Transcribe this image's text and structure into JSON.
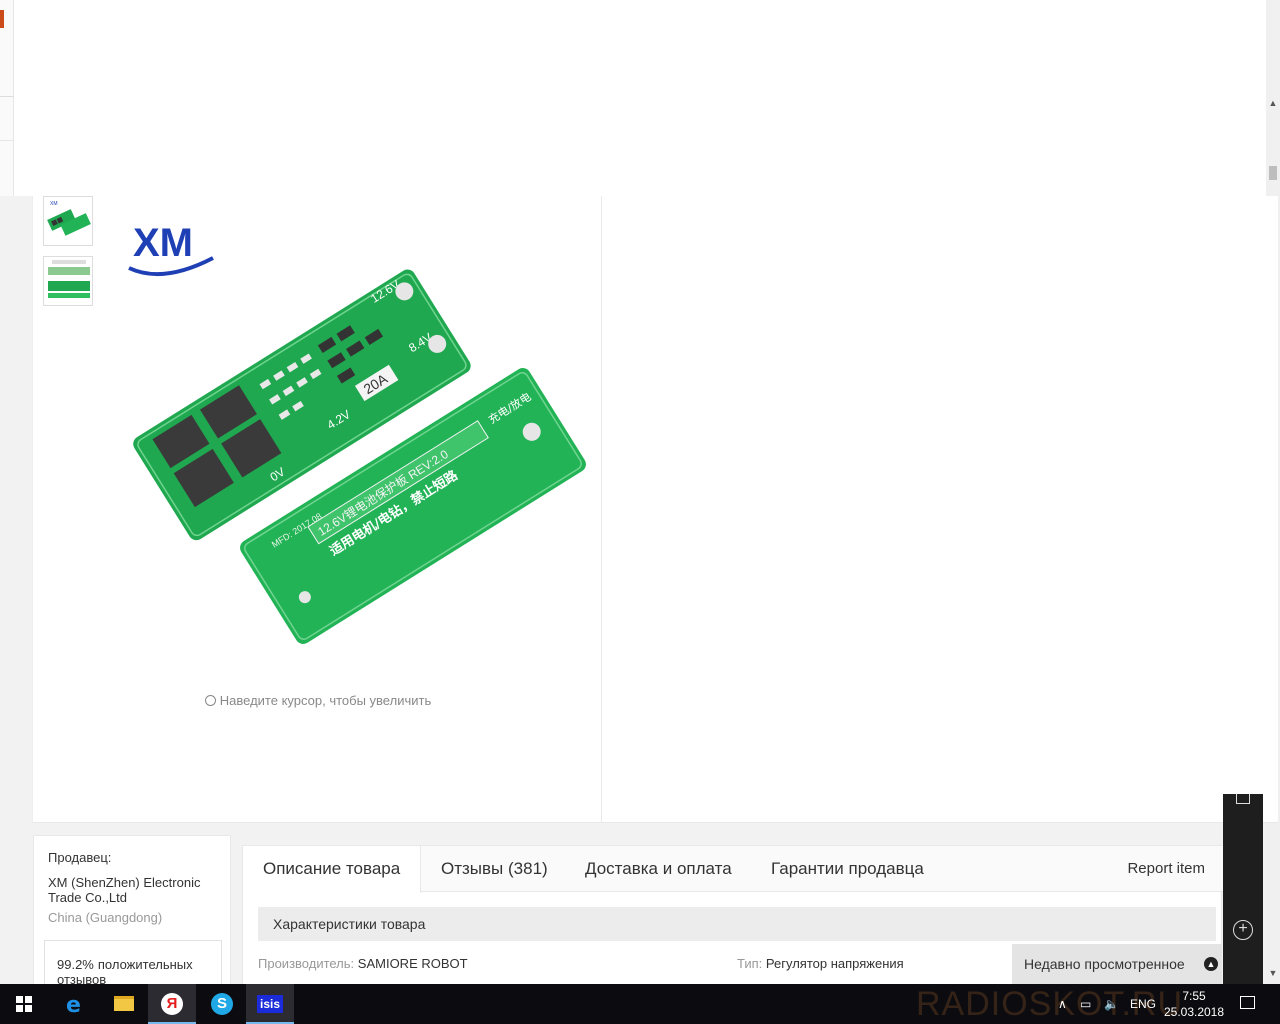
{
  "gallery": {
    "zoom_hint": "Наведите курсор, чтобы увеличить",
    "brand_logo_text": "XM",
    "photo_labels": {
      "v126": "12.6V",
      "v84": "8.4V",
      "amp": "20A",
      "v42": "4.2V",
      "v0": "0V",
      "rev": "12.6V锂电池保护板 REV:2.0",
      "mfd": "MFD: 2017.08",
      "warn": "适用电机/电钻，禁止短路",
      "charge": "充电/放电"
    }
  },
  "seller": {
    "label": "Продавец:",
    "name": "XM (ShenZhen) Electronic Trade Co.,Ltd",
    "location": "China (Guangdong)",
    "rating_value": "99.2%",
    "rating_text": "положительных отзывов"
  },
  "tabs": {
    "items": [
      {
        "label": "Описание товара"
      },
      {
        "label": "Отзывы (381)"
      },
      {
        "label": "Доставка и оплата"
      },
      {
        "label": "Гарантии продавца"
      }
    ],
    "report": "Report item"
  },
  "specs": {
    "title": "Характеристики товара",
    "manufacturer_key": "Производитель:",
    "manufacturer_value": "SAMIORE ROBOT",
    "type_key": "Тип:",
    "type_value": "Регулятор напряжения"
  },
  "recent": {
    "label": "Недавно просмотренное"
  },
  "taskbar": {
    "watermark": "RADIOSKOT.RU",
    "lang": "ENG",
    "time": "7:55",
    "date": "25.03.2018",
    "ya_glyph": "Я",
    "skype_glyph": "S",
    "isis_label": "isis",
    "edge_glyph": "e"
  },
  "icons": {
    "accent": "#cc4b1a",
    "pcb_green": "#1fa84f",
    "logo_blue": "#1f3fb5"
  }
}
